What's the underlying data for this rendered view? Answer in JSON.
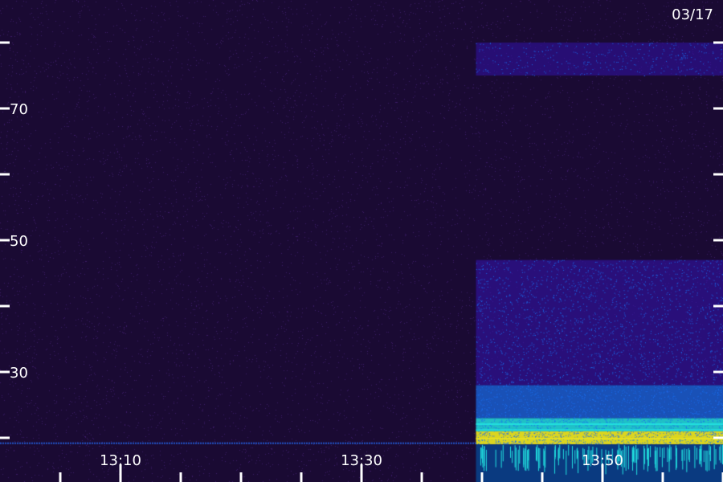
{
  "chart_data": {
    "type": "heatmap",
    "title": "",
    "date_label": "03/17",
    "xlabel": "",
    "ylabel": "",
    "x_tick_labels": [
      "13:10",
      "13:30",
      "13:50"
    ],
    "x_tick_values_min": [
      10,
      30,
      50
    ],
    "x_minor_tick_values_min": [
      5,
      10,
      15,
      20,
      25,
      30,
      35,
      40,
      45,
      50,
      55,
      60
    ],
    "x_range_min": [
      0,
      60
    ],
    "y_tick_labels": [
      "70",
      "50",
      "30"
    ],
    "y_tick_values": [
      70,
      50,
      30
    ],
    "y_minor_tick_values": [
      80,
      70,
      60,
      50,
      40,
      30,
      20
    ],
    "y_range": [
      19,
      85
    ],
    "signal_onset_min": 39.5,
    "noise_floor_level": 0.15,
    "bands": [
      {
        "y_from": 19,
        "y_to": 21,
        "level": 1.0
      },
      {
        "y_from": 21,
        "y_to": 23,
        "level": 0.8
      },
      {
        "y_from": 23,
        "y_to": 28,
        "level": 0.5
      },
      {
        "y_from": 28,
        "y_to": 47,
        "level": 0.3
      },
      {
        "y_from": 75,
        "y_to": 80,
        "level": 0.2
      }
    ],
    "colors": {
      "background": "#1a0a33",
      "noise": "#3a1a66",
      "low": "#3312aa",
      "mid": "#1a6ff0",
      "high": "#22e0e0",
      "peak": "#e6e020",
      "text": "#ffffff"
    }
  }
}
